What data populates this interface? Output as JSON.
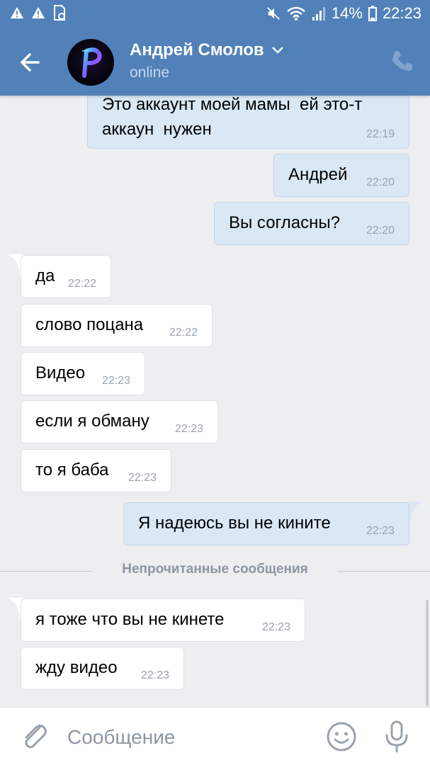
{
  "status_bar": {
    "battery": "14%",
    "time": "22:23",
    "icons": [
      "warning-icon",
      "warning-icon",
      "storage-icon",
      "mute-icon",
      "wifi-icon",
      "signal-icon",
      "battery-icon"
    ]
  },
  "header": {
    "name": "Андрей Смолов",
    "status": "online",
    "icons": [
      "back-arrow-icon",
      "chevron-down-icon",
      "phone-icon"
    ]
  },
  "messages": [
    {
      "dir": "out",
      "text": "Это аккаунт моей мамы  ей это-т\nаккаун  нужен",
      "time": "22:19"
    },
    {
      "dir": "out",
      "text": "Андрей",
      "time": "22:20"
    },
    {
      "dir": "out",
      "text": "Вы согласны?",
      "time": "22:20"
    },
    {
      "dir": "in",
      "text": "да",
      "time": "22:22"
    },
    {
      "dir": "in",
      "text": "слово поцана",
      "time": "22:22"
    },
    {
      "dir": "in",
      "text": "Видео",
      "time": "22:23"
    },
    {
      "dir": "in",
      "text": "если я обману",
      "time": "22:23"
    },
    {
      "dir": "in",
      "text": "то я баба",
      "time": "22:23"
    },
    {
      "dir": "out",
      "text": "Я надеюсь вы не кините",
      "time": "22:23"
    },
    {
      "dir": "in",
      "text": "я тоже что вы не кинете",
      "time": "22:23"
    },
    {
      "dir": "in",
      "text": "жду видео",
      "time": "22:23"
    }
  ],
  "divider_label": "Непрочитанные сообщения",
  "composer": {
    "placeholder": "Сообщение",
    "value": "",
    "icons": [
      "paperclip-icon",
      "emoji-icon",
      "microphone-icon"
    ]
  },
  "colors": {
    "header_bg": "#5181b8",
    "outgoing_bubble": "#dae7f5",
    "incoming_bubble": "#ffffff",
    "chat_bg": "#edeef0"
  }
}
